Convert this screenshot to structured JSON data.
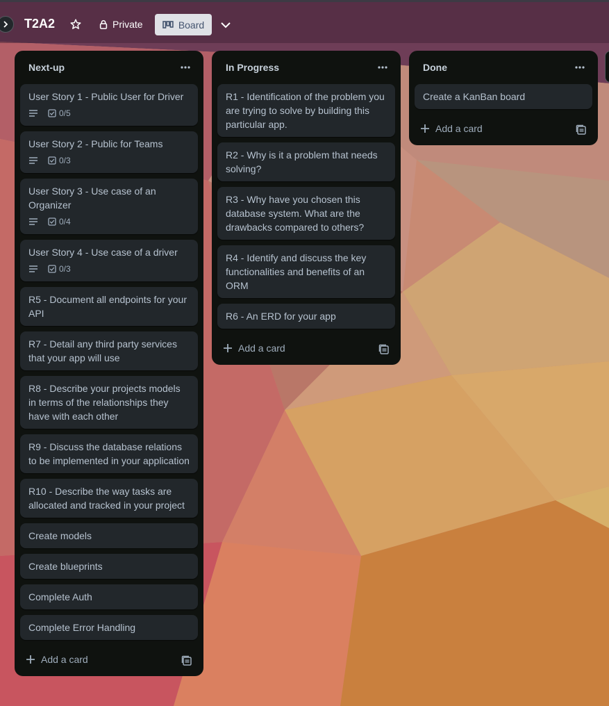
{
  "board": {
    "title": "T2A2",
    "visibility": "Private",
    "view": "Board"
  },
  "lists": [
    {
      "title": "Next-up",
      "cards": [
        {
          "text": "User Story 1 - Public User for Driver",
          "checklist": "0/5",
          "has_description": true
        },
        {
          "text": "User Story 2 - Public for Teams",
          "checklist": "0/3",
          "has_description": true
        },
        {
          "text": "User Story 3 - Use case of an Organizer",
          "checklist": "0/4",
          "has_description": true
        },
        {
          "text": "User Story 4 - Use case of a driver",
          "checklist": "0/3",
          "has_description": true
        },
        {
          "text": "R5 - Document all endpoints for your API"
        },
        {
          "text": "R7 - Detail any third party services that your app will use"
        },
        {
          "text": "R8 - Describe your projects models in terms of the relationships they have with each other"
        },
        {
          "text": "R9 - Discuss the database relations to be implemented in your application"
        },
        {
          "text": "R10 - Describe the way tasks are allocated and tracked in your project"
        },
        {
          "text": "Create models"
        },
        {
          "text": "Create blueprints"
        },
        {
          "text": "Complete Auth"
        },
        {
          "text": "Complete Error Handling"
        }
      ],
      "add_label": "Add a card"
    },
    {
      "title": "In Progress",
      "cards": [
        {
          "text": "R1 - Identification of the problem you are trying to solve by building this particular app."
        },
        {
          "text": "R2 - Why is it a problem that needs solving?"
        },
        {
          "text": "R3 - Why have you chosen this database system. What are the drawbacks compared to others?"
        },
        {
          "text": "R4 - Identify and discuss the key functionalities and benefits of an ORM"
        },
        {
          "text": "R6 - An ERD for your app"
        }
      ],
      "add_label": "Add a card"
    },
    {
      "title": "Done",
      "cards": [
        {
          "text": "Create a KanBan board"
        }
      ],
      "add_label": "Add a card"
    }
  ],
  "icons": {
    "star": "star-icon",
    "lock": "lock-icon",
    "board": "board-view-icon",
    "chevron": "chevron-down-icon",
    "menu": "more-horizontal-icon",
    "description": "description-lines-icon",
    "checklist": "checklist-icon",
    "add": "plus-icon",
    "template": "card-template-icon"
  },
  "colors": {
    "list_bg": "#0f120f",
    "card_bg": "#22272b",
    "text": "#b6c2cf",
    "header_text": "#c7d1db",
    "board_btn_bg": "#dfe1e6"
  }
}
